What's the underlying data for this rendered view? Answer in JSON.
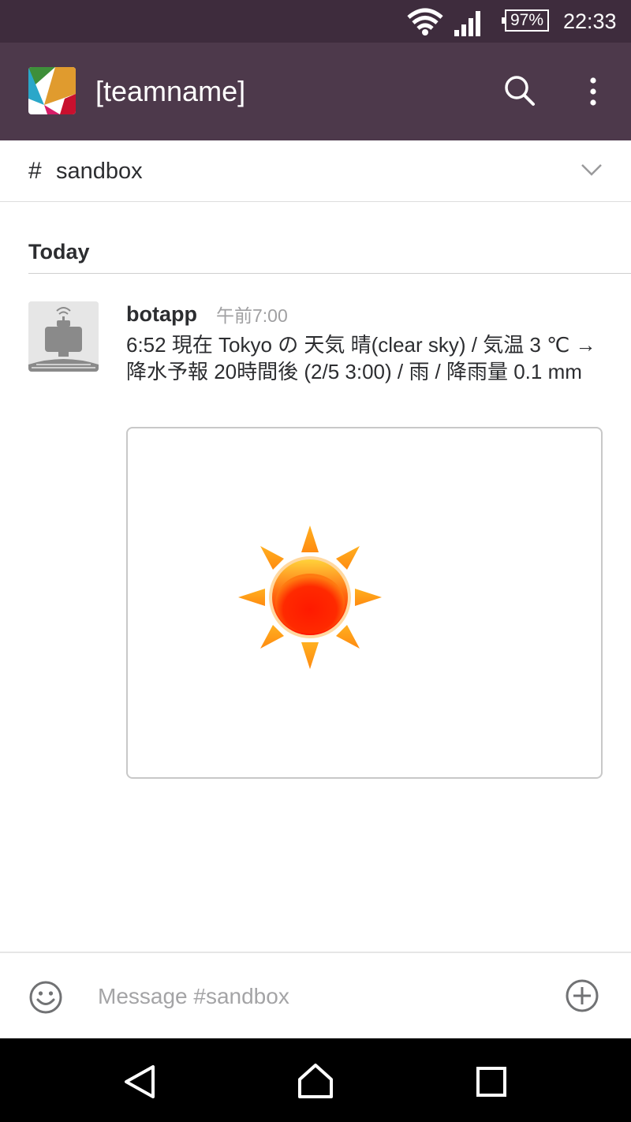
{
  "status_bar": {
    "battery": "97%",
    "time": "22:33"
  },
  "app_bar": {
    "team_name": "[teamname]"
  },
  "channel": {
    "hash": "#",
    "name": "sandbox"
  },
  "day_divider": "Today",
  "message": {
    "author": "botapp",
    "time": "午前7:00",
    "text": "6:52 現在 Tokyo の 天気 晴(clear sky) / 気温 3 ℃ → 降水予報 20時間後 (2/5 3:00) / 雨 / 降雨量 0.1 mm"
  },
  "compose": {
    "placeholder": "Message #sandbox"
  },
  "colors": {
    "status_bar_bg": "#3e2c3d",
    "app_bar_bg": "#4d394b",
    "nav_bar_bg": "#000000"
  },
  "icons": [
    "wifi-icon",
    "cell-signal-icon",
    "battery-icon",
    "search-icon",
    "overflow-menu-icon",
    "chevron-down-icon",
    "bot-avatar-icon",
    "sun-weather-icon",
    "emoji-icon",
    "add-attachment-icon",
    "back-icon",
    "home-icon",
    "recents-icon"
  ]
}
